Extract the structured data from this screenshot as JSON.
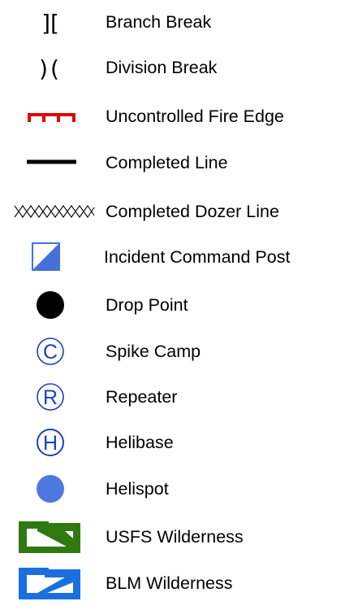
{
  "legend": {
    "items": [
      {
        "label": "Branch Break",
        "symbol": "branch-break",
        "glyph": "][",
        "color": "#000000"
      },
      {
        "label": "Division Break",
        "symbol": "division-break",
        "glyph": ")(",
        "color": "#000000"
      },
      {
        "label": "Uncontrolled Fire Edge",
        "symbol": "uncontrolled-fire-edge",
        "color": "#e60000"
      },
      {
        "label": "Completed Line",
        "symbol": "completed-line",
        "color": "#000000"
      },
      {
        "label": "Completed Dozer Line",
        "symbol": "completed-dozer-line",
        "color": "#000000"
      },
      {
        "label": "Incident Command Post",
        "symbol": "incident-command-post",
        "color": "#4472d9"
      },
      {
        "label": "Drop Point",
        "symbol": "drop-point",
        "color": "#000000"
      },
      {
        "label": "Spike Camp",
        "symbol": "spike-camp",
        "glyph": "C",
        "color": "#1f3fbf"
      },
      {
        "label": "Repeater",
        "symbol": "repeater",
        "glyph": "R",
        "color": "#1f3fbf"
      },
      {
        "label": "Helibase",
        "symbol": "helibase",
        "glyph": "H",
        "color": "#1f3fbf"
      },
      {
        "label": "Helispot",
        "symbol": "helispot",
        "color": "#4d78e0"
      },
      {
        "label": "USFS Wilderness",
        "symbol": "usfs-wilderness",
        "color": "#2f7a10"
      },
      {
        "label": "BLM Wilderness",
        "symbol": "blm-wilderness",
        "color": "#1a6fe0"
      }
    ]
  }
}
